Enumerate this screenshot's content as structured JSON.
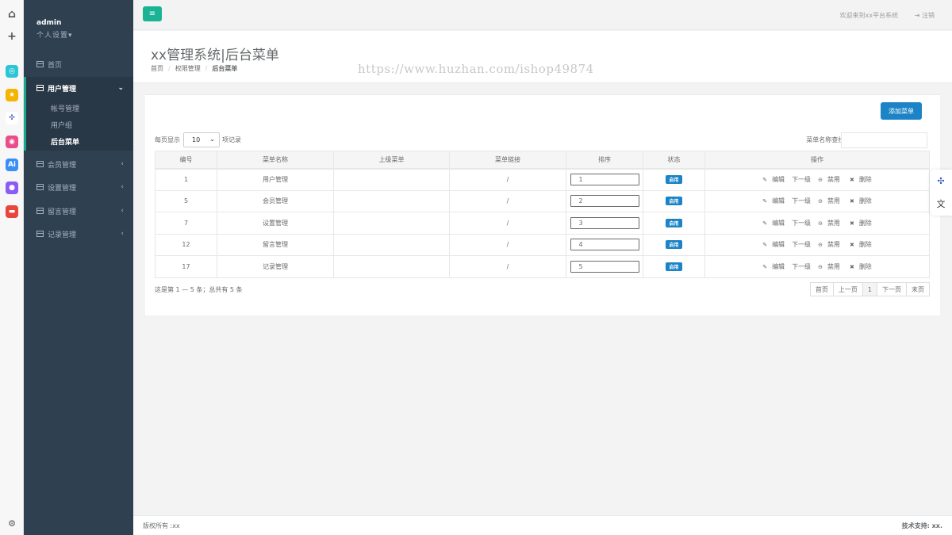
{
  "sidebar": {
    "user": {
      "name": "admin",
      "settings": "个人设置"
    },
    "nav": [
      {
        "label": "首页"
      },
      {
        "label": "用户管理"
      },
      {
        "label": "会员管理"
      },
      {
        "label": "设置管理"
      },
      {
        "label": "留言管理"
      },
      {
        "label": "记录管理"
      }
    ],
    "submenu": [
      {
        "label": "帐号管理"
      },
      {
        "label": "用户组"
      },
      {
        "label": "后台菜单"
      }
    ]
  },
  "topbar": {
    "welcome": "欢迎来到xx平台系统",
    "logout": "注销"
  },
  "heading": {
    "title": "xx管理系统|后台菜单",
    "breadcrumb": [
      "首页",
      "权限管理",
      "后台菜单"
    ]
  },
  "watermark": "https://www.huzhan.com/ishop49874",
  "content": {
    "add_button": "添加菜单",
    "length_prefix": "每页显示",
    "length_value": "10",
    "length_suffix": "项记录",
    "search_label": "菜单名称查找:",
    "columns": [
      "编号",
      "菜单名称",
      "上级菜单",
      "菜单链接",
      "排序",
      "状态",
      "操作"
    ],
    "rows": [
      {
        "id": "1",
        "name": "用户管理",
        "parent": "",
        "link": "/",
        "sort": "1",
        "status": "启用"
      },
      {
        "id": "5",
        "name": "会员管理",
        "parent": "",
        "link": "/",
        "sort": "2",
        "status": "启用"
      },
      {
        "id": "7",
        "name": "设置管理",
        "parent": "",
        "link": "/",
        "sort": "3",
        "status": "启用"
      },
      {
        "id": "12",
        "name": "留言管理",
        "parent": "",
        "link": "/",
        "sort": "4",
        "status": "启用"
      },
      {
        "id": "17",
        "name": "记录管理",
        "parent": "",
        "link": "/",
        "sort": "5",
        "status": "启用"
      }
    ],
    "actions": {
      "edit": "编辑",
      "child": "下一级",
      "disable": "禁用",
      "delete": "删除"
    },
    "info": "这是第 1 — 5 条；总共有 5 条",
    "pager": [
      "首页",
      "上一页",
      "1",
      "下一页",
      "末页"
    ]
  },
  "footer": {
    "copyright": "版权所有 :xx",
    "support": "技术支持: xx."
  },
  "colors": {
    "sidebar": "#2f4050",
    "accent_green": "#1ab394",
    "accent_blue": "#1c84c6"
  },
  "icons": [
    "home-icon",
    "plus-icon",
    "star-icon",
    "network-icon",
    "ai-icon",
    "game-icon",
    "settings-icon",
    "translate-icon",
    "menu-icon",
    "logout-icon"
  ]
}
